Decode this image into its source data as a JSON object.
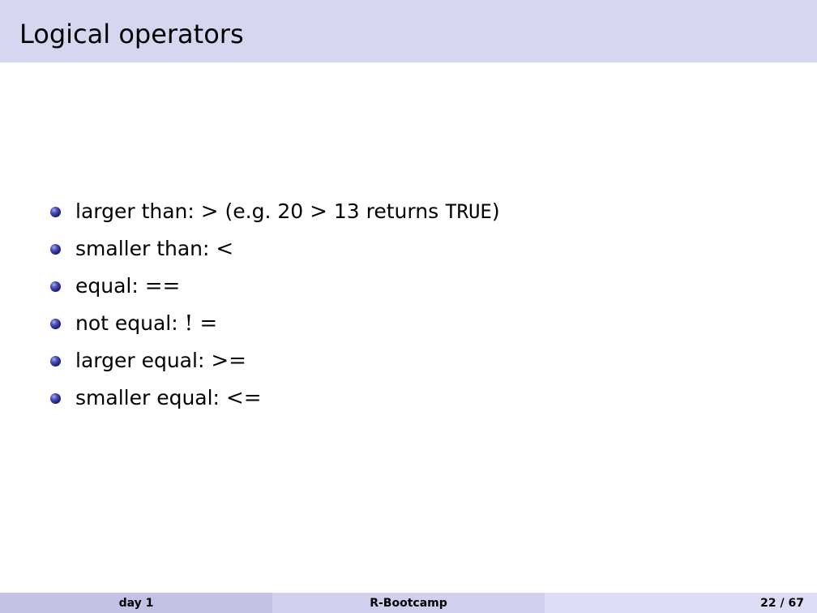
{
  "slide": {
    "title": "Logical operators",
    "bullets": [
      {
        "label": "larger than:",
        "operator": ">",
        "example_prefix": "(e.g. 20",
        "example_operator": ">",
        "example_middle": "13 returns",
        "example_value": "TRUE",
        "example_suffix": ")"
      },
      {
        "label": "smaller than:",
        "operator": "<"
      },
      {
        "label": "equal:",
        "operator": "=="
      },
      {
        "label": "not equal:",
        "operator": "! ="
      },
      {
        "label": "larger equal:",
        "operator": ">="
      },
      {
        "label": "smaller equal:",
        "operator": "<="
      }
    ]
  },
  "footer": {
    "left": "day 1",
    "center": "R-Bootcamp",
    "right": "22 / 67"
  },
  "colors": {
    "title_bar": "#d6d6f0",
    "footer_left": "#c2c2e6",
    "footer_center": "#d0d0ee",
    "footer_right": "#dcdcf4",
    "bullet": "#2a2f8f"
  }
}
